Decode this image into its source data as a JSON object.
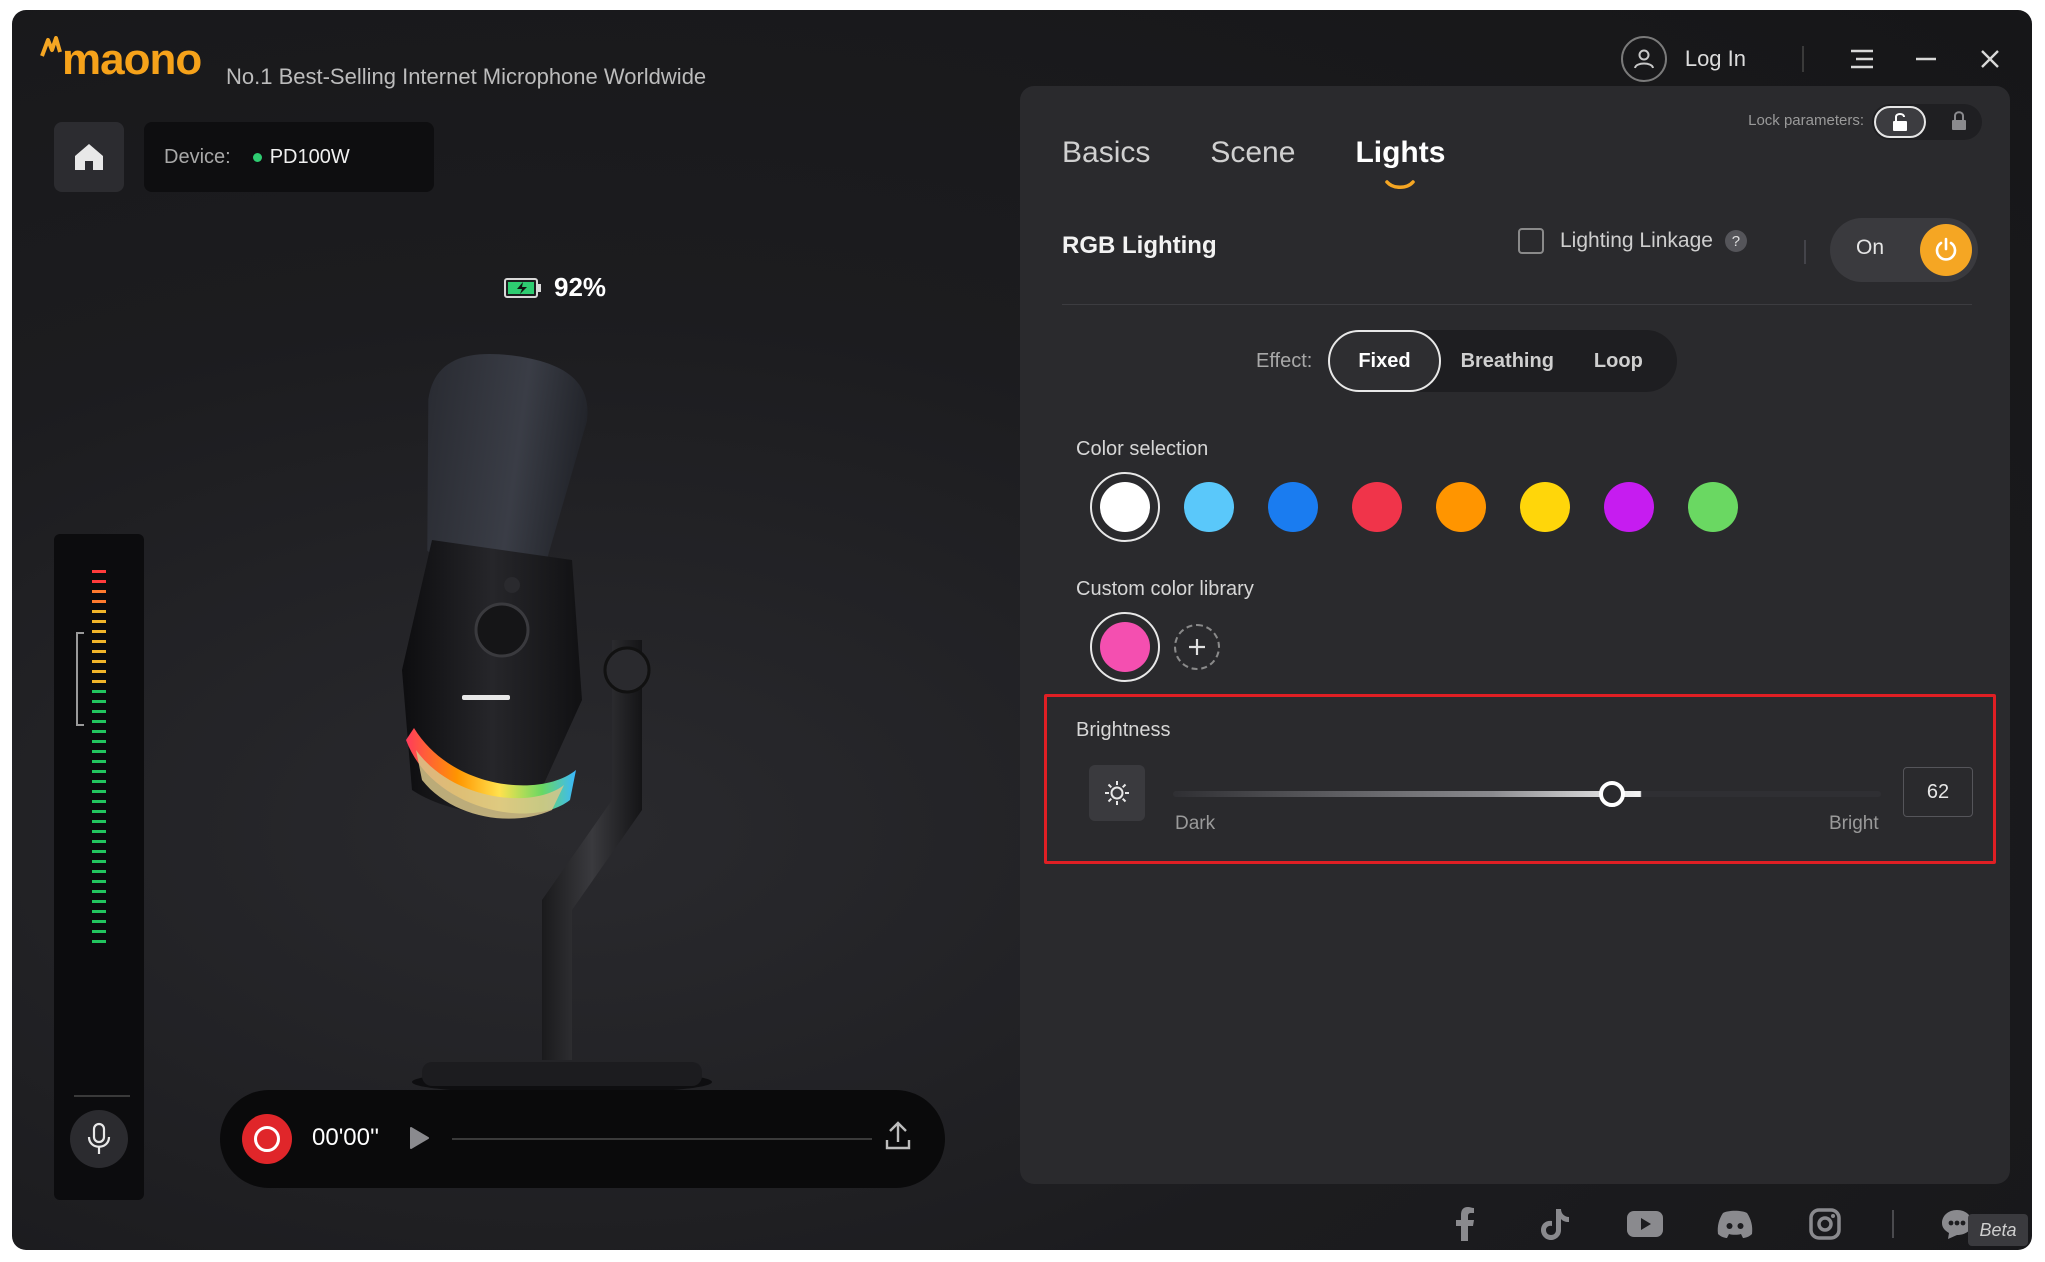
{
  "app": {
    "brand": "maono",
    "tagline": "No.1 Best-Selling Internet Microphone Worldwide",
    "login_label": "Log In",
    "accent_color": "#f5a623"
  },
  "device": {
    "label": "Device:",
    "name": "PD100W",
    "status_color": "#2ecc71",
    "battery_percent": "92%"
  },
  "meter": {
    "level_bars": 38
  },
  "recorder": {
    "time": "00'00''"
  },
  "panel": {
    "lock_label": "Lock parameters:",
    "lock_state": "unlocked",
    "tabs": [
      {
        "label": "Basics",
        "active": false
      },
      {
        "label": "Scene",
        "active": false
      },
      {
        "label": "Lights",
        "active": true
      }
    ],
    "rgb": {
      "title": "RGB Lighting",
      "linkage_label": "Lighting Linkage",
      "linkage_checked": false,
      "help": "?",
      "power_label": "On",
      "power_on": true
    },
    "effect": {
      "label": "Effect:",
      "options": [
        "Fixed",
        "Breathing",
        "Loop"
      ],
      "selected": "Fixed"
    },
    "color_selection": {
      "label": "Color selection",
      "colors": [
        "#ffffff",
        "#5ac8fa",
        "#1a7cf0",
        "#f0344a",
        "#ff9500",
        "#ffd60a",
        "#c61cf0",
        "#6ad862"
      ],
      "selected_index": 0
    },
    "custom_library": {
      "label": "Custom color library",
      "colors": [
        "#f44fb0"
      ],
      "add_label": "+"
    },
    "brightness": {
      "label": "Brightness",
      "min_label": "Dark",
      "max_label": "Bright",
      "value": "62",
      "fraction": 0.62
    }
  },
  "footer": {
    "social_icons": [
      "facebook-icon",
      "tiktok-icon",
      "youtube-icon",
      "discord-icon",
      "instagram-icon"
    ],
    "feedback_icon": "feedback-icon",
    "beta_label": "Beta"
  }
}
